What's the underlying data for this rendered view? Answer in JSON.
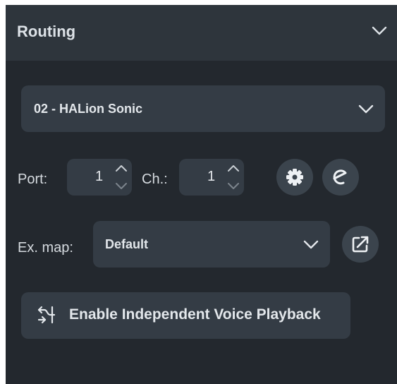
{
  "routing": {
    "title": "Routing",
    "device": {
      "selected": "02 - HALion Sonic"
    },
    "port": {
      "label": "Port:",
      "value": "1"
    },
    "channel": {
      "label": "Ch.:",
      "value": "1"
    },
    "expression_map": {
      "label": "Ex. map:",
      "selected": "Default"
    },
    "voice_playback": {
      "label": "Enable Independent Voice Playback"
    }
  },
  "icons": {
    "header_toggle": "chevron-down-icon",
    "device_dropdown": "chevron-down-icon",
    "port_stepper": "stepper-arrows-icon",
    "channel_stepper": "stepper-arrows-icon",
    "settings": "gear-icon",
    "edit": "edit-e-icon",
    "map_dropdown": "chevron-down-icon",
    "open_editor": "open-external-icon",
    "voice_playback": "split-arrows-icon"
  },
  "colors": {
    "panel_bg": "#23282e",
    "header_bg": "#2e353c",
    "control_bg": "#343c45",
    "round_button_bg": "#3b444d",
    "text": "#e3e7eb"
  }
}
